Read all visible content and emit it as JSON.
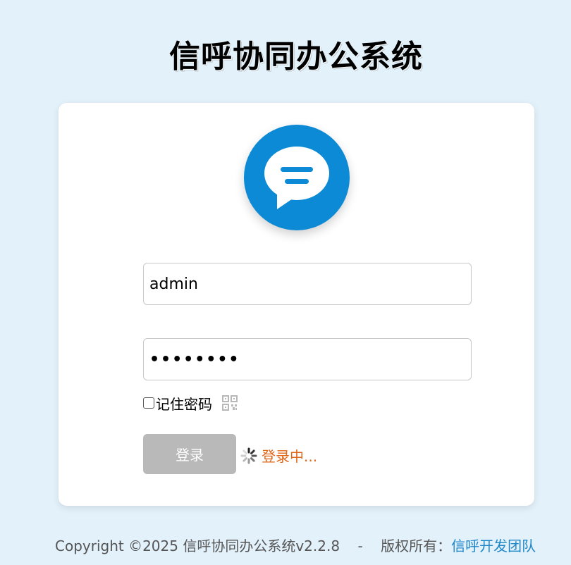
{
  "header": {
    "title": "信呼协同办公系统"
  },
  "login": {
    "username_value": "admin",
    "password_mask": "••••••••",
    "remember_label": "记住密码",
    "login_button": "登录",
    "status_text": "登录中..."
  },
  "footer": {
    "copyright": "Copyright ©2025 信呼协同办公系统v2.2.8",
    "separator": "-",
    "rights_label": "版权所有：",
    "team_link": "信呼开发团队"
  },
  "icons": {
    "logo": "chat-bubble-icon",
    "qr": "qr-code-icon",
    "spinner": "loading-spinner-icon"
  },
  "colors": {
    "background": "#e3f1fb",
    "logo_blue": "#0c8ad6",
    "loading_orange": "#e0661a",
    "link_blue": "#1f86c8",
    "button_disabled": "#b9b9b9"
  }
}
